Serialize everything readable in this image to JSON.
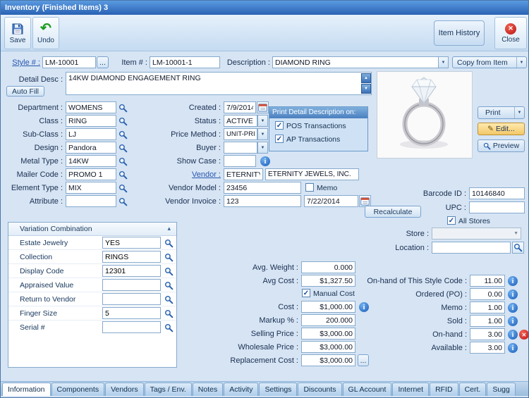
{
  "window": {
    "title": "Inventory (Finished Items) 3"
  },
  "colors": {
    "titlebar": "#2f6bc0",
    "accent": "#2a62b0",
    "edit_button": "#f2c868",
    "alert": "#cc2222"
  },
  "icons": {
    "undo": "↶",
    "close_x": "✕",
    "dropdown": "▼",
    "up": "▲",
    "down": "▼",
    "check": "✓",
    "collapse": "▴",
    "info": "i",
    "stop": "✕",
    "edit": "✎",
    "ellipsis": "..."
  },
  "toolbar": {
    "save": "Save",
    "undo": "Undo",
    "item_history": "Item History",
    "close": "Close"
  },
  "header": {
    "style_label": "Style # :",
    "style_value": "LM-10001",
    "item_label": "Item # :",
    "item_value": "LM-10001-1",
    "desc_label": "Description :",
    "desc_value": "DIAMOND RING",
    "copy_label": "Copy from Item"
  },
  "detail": {
    "label": "Detail Desc :",
    "value": "14KW DIAMOND ENGAGEMENT RING",
    "autofill": "Auto Fill"
  },
  "left_fields": [
    {
      "label": "Department :",
      "value": "WOMENS"
    },
    {
      "label": "Class :",
      "value": "RING"
    },
    {
      "label": "Sub-Class :",
      "value": "LJ"
    },
    {
      "label": "Design :",
      "value": "Pandora"
    },
    {
      "label": "Metal Type :",
      "value": "14KW"
    },
    {
      "label": "Mailer Code :",
      "value": "PROMO 1"
    },
    {
      "label": "Element Type :",
      "value": "MIX"
    },
    {
      "label": "Attribute :",
      "value": ""
    }
  ],
  "mid": {
    "created_label": "Created :",
    "created_value": "7/9/2014",
    "status_label": "Status :",
    "status_value": "ACTIVE",
    "pm_label": "Price Method :",
    "pm_value": "UNIT-PRICE",
    "buyer_label": "Buyer :",
    "buyer_value": "",
    "showcase_label": "Show Case :",
    "showcase_value": "",
    "vendor_label": "Vendor :",
    "vendor_value": "ETERNITY",
    "vendor_name": "ETERNITY JEWELS, INC.",
    "vmodel_label": "Vendor Model :",
    "vmodel_value": "23456",
    "memo_label": "Memo",
    "memo_checked": false,
    "vinv_label": "Vendor Invoice :",
    "vinv_value": "123",
    "inv_date": "7/22/2014"
  },
  "print_panel": {
    "title": "Print Detail Description on:",
    "pos": "POS Transactions",
    "pos_checked": true,
    "ap": "AP Transactions",
    "ap_checked": true
  },
  "side": {
    "print": "Print",
    "edit": "Edit...",
    "preview": "Preview"
  },
  "right": {
    "barcode_label": "Barcode ID :",
    "barcode_value": "10146840",
    "upc_label": "UPC :",
    "upc_value": "",
    "all_stores": "All Stores",
    "all_stores_checked": true,
    "store_label": "Store :",
    "store_value": "",
    "location_label": "Location :",
    "location_value": ""
  },
  "recalc": "Recalculate",
  "variation": {
    "title": "Variation Combination",
    "rows": [
      {
        "label": "Estate Jewelry",
        "value": "YES"
      },
      {
        "label": "Collection",
        "value": "RINGS"
      },
      {
        "label": "Display Code",
        "value": "12301"
      },
      {
        "label": "Appraised Value",
        "value": ""
      },
      {
        "label": "Return to Vendor",
        "value": ""
      },
      {
        "label": "Finger Size",
        "value": "5"
      },
      {
        "label": "Serial #",
        "value": ""
      }
    ]
  },
  "costs": {
    "avg_weight_label": "Avg. Weight :",
    "avg_weight_value": "0.000",
    "avg_cost_label": "Avg Cost :",
    "avg_cost_value": "$1,327.50",
    "manual": "Manual Cost",
    "manual_checked": true,
    "cost_label": "Cost :",
    "cost_value": "$1,000.00",
    "markup_label": "Markup % :",
    "markup_value": "200.000",
    "selling_label": "Selling Price :",
    "selling_value": "$3,000.00",
    "wholesale_label": "Wholesale Price :",
    "wholesale_value": "$3,000.00",
    "repl_label": "Replacement Cost :",
    "repl_value": "$3,000.00"
  },
  "stock": [
    {
      "label": "On-hand of This Style Code :",
      "value": "11.00"
    },
    {
      "label": "Ordered (PO) :",
      "value": "0.00"
    },
    {
      "label": "Memo :",
      "value": "1.00"
    },
    {
      "label": "Sold :",
      "value": "1.00"
    },
    {
      "label": "On-hand :",
      "value": "3.00"
    },
    {
      "label": "Available :",
      "value": "3.00"
    }
  ],
  "tabs": [
    {
      "label": "Information",
      "active": true
    },
    {
      "label": "Components"
    },
    {
      "label": "Vendors"
    },
    {
      "label": "Tags / Env."
    },
    {
      "label": "Notes"
    },
    {
      "label": "Activity"
    },
    {
      "label": "Settings"
    },
    {
      "label": "Discounts"
    },
    {
      "label": "GL Account"
    },
    {
      "label": "Internet"
    },
    {
      "label": "RFID"
    },
    {
      "label": "Cert."
    },
    {
      "label": "Sugg"
    }
  ]
}
